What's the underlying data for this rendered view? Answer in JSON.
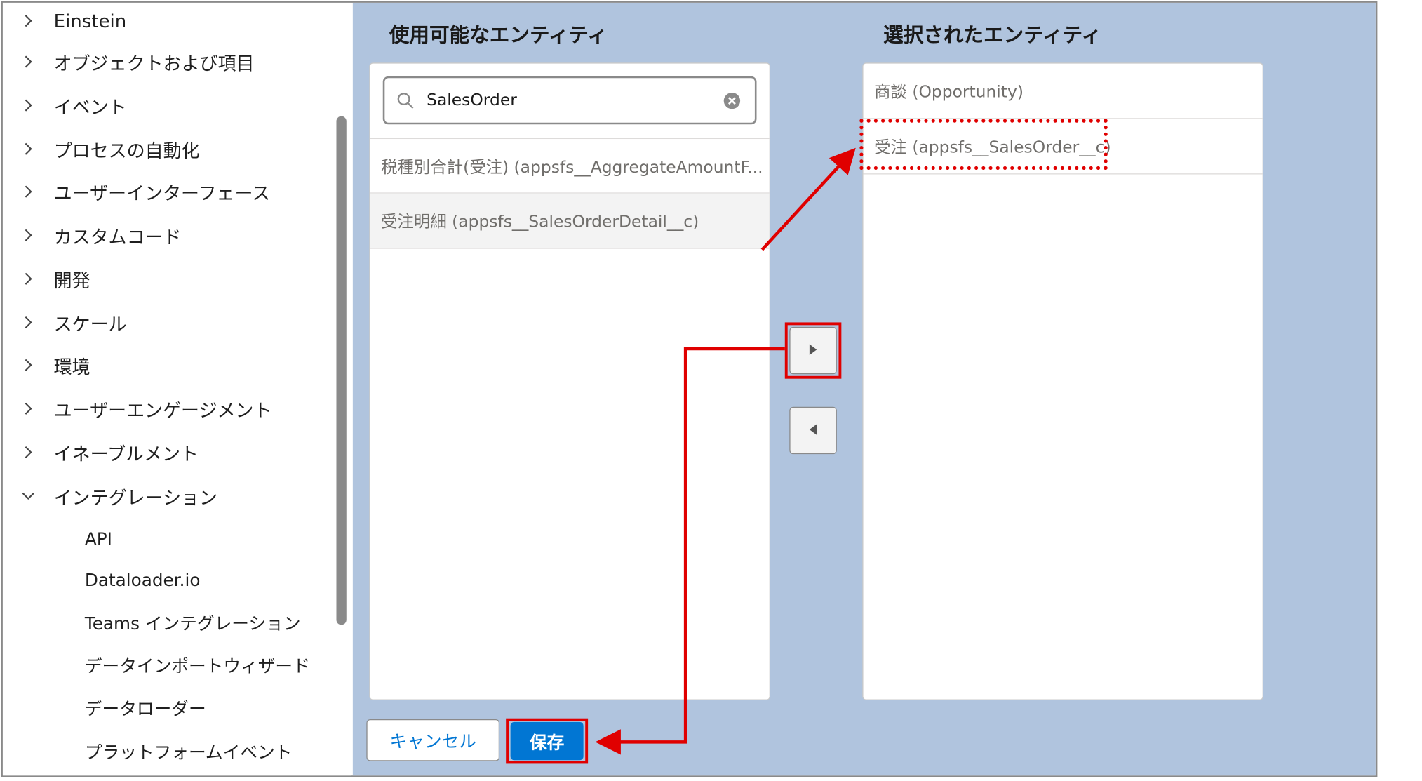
{
  "sidebar": {
    "items": [
      {
        "label": "Einstein"
      },
      {
        "label": "オブジェクトおよび項目"
      },
      {
        "label": "イベント"
      },
      {
        "label": "プロセスの自動化"
      },
      {
        "label": "ユーザーインターフェース"
      },
      {
        "label": "カスタムコード"
      },
      {
        "label": "開発"
      },
      {
        "label": "スケール"
      },
      {
        "label": "環境"
      },
      {
        "label": "ユーザーエンゲージメント"
      },
      {
        "label": "イネーブルメント"
      },
      {
        "label": "インテグレーション"
      }
    ],
    "children": [
      {
        "label": "API"
      },
      {
        "label": "Dataloader.io"
      },
      {
        "label": "Teams インテグレーション"
      },
      {
        "label": "データインポートウィザード"
      },
      {
        "label": "データローダー"
      },
      {
        "label": "プラットフォームイベント"
      }
    ]
  },
  "available": {
    "heading": "使用可能なエンティティ",
    "search": {
      "value": "SalesOrder"
    },
    "items": [
      {
        "label": "税種別合計(受注) (appsfs__AggregateAmountF..."
      },
      {
        "label": "受注明細 (appsfs__SalesOrderDetail__c)"
      }
    ]
  },
  "selected": {
    "heading": "選択されたエンティティ",
    "items": [
      {
        "label": "商談 (Opportunity)"
      },
      {
        "label": "受注 (appsfs__SalesOrder__c)"
      }
    ]
  },
  "footer": {
    "cancel_label": "キャンセル",
    "save_label": "保存"
  },
  "colors": {
    "panel_bg": "#b0c4de",
    "brand_blue": "#0176d3",
    "highlight_red": "#e00000"
  },
  "icons": {
    "search": "search-icon",
    "clear": "clear-icon",
    "move_right": "chevron-right-icon",
    "move_left": "chevron-left-icon",
    "expand": "chevron-right-icon",
    "collapse": "chevron-down-icon"
  }
}
